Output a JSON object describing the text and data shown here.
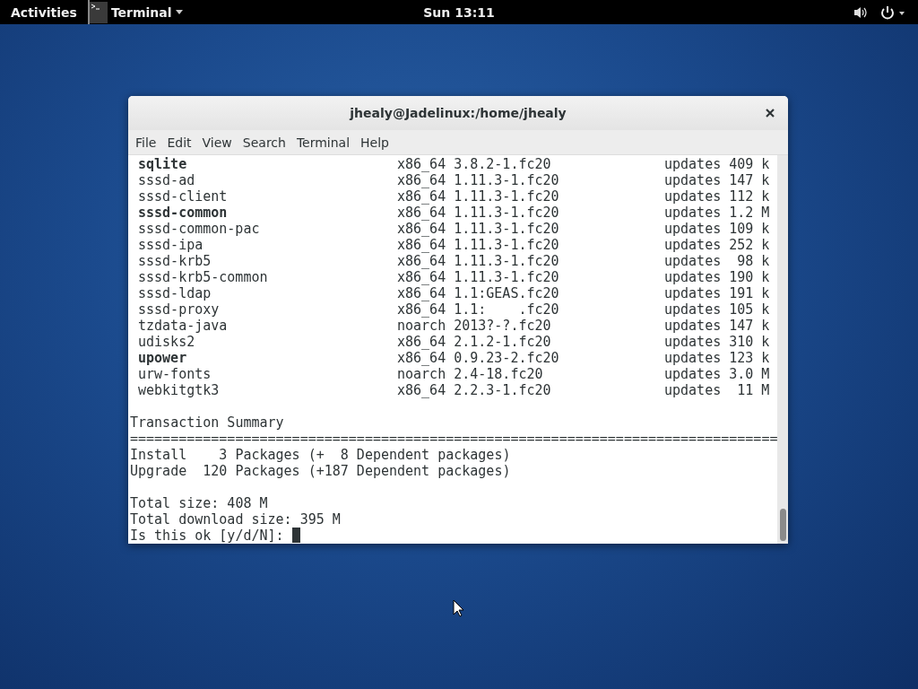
{
  "top_bar": {
    "activities": "Activities",
    "app_menu": "Terminal",
    "clock": "Sun 13:11"
  },
  "window": {
    "title": "jhealy@Jadelinux:/home/jhealy",
    "menu": [
      "File",
      "Edit",
      "View",
      "Search",
      "Terminal",
      "Help"
    ],
    "packages": [
      {
        "name": "sqlite",
        "bold": true,
        "arch": "x86_64",
        "version": "3.8.2-1.fc20",
        "repo": "updates",
        "size": "409 k"
      },
      {
        "name": "sssd-ad",
        "bold": false,
        "arch": "x86_64",
        "version": "1.11.3-1.fc20",
        "repo": "updates",
        "size": "147 k"
      },
      {
        "name": "sssd-client",
        "bold": false,
        "arch": "x86_64",
        "version": "1.11.3-1.fc20",
        "repo": "updates",
        "size": "112 k"
      },
      {
        "name": "sssd-common",
        "bold": true,
        "arch": "x86_64",
        "version": "1.11.3-1.fc20",
        "repo": "updates",
        "size": "1.2 M"
      },
      {
        "name": "sssd-common-pac",
        "bold": false,
        "arch": "x86_64",
        "version": "1.11.3-1.fc20",
        "repo": "updates",
        "size": "109 k"
      },
      {
        "name": "sssd-ipa",
        "bold": false,
        "arch": "x86_64",
        "version": "1.11.3-1.fc20",
        "repo": "updates",
        "size": "252 k"
      },
      {
        "name": "sssd-krb5",
        "bold": false,
        "arch": "x86_64",
        "version": "1.11.3-1.fc20",
        "repo": "updates",
        "size": "98 k"
      },
      {
        "name": "sssd-krb5-common",
        "bold": false,
        "arch": "x86_64",
        "version": "1.11.3-1.fc20",
        "repo": "updates",
        "size": "190 k"
      },
      {
        "name": "sssd-ldap",
        "bold": false,
        "arch": "x86_64",
        "version": "1.1:GEAS.fc20",
        "repo": "updates",
        "size": "191 k"
      },
      {
        "name": "sssd-proxy",
        "bold": false,
        "arch": "x86_64",
        "version": "1.1:    .fc20",
        "repo": "updates",
        "size": "105 k"
      },
      {
        "name": "tzdata-java",
        "bold": false,
        "arch": "noarch",
        "version": "2013?-?.fc20",
        "repo": "updates",
        "size": "147 k"
      },
      {
        "name": "udisks2",
        "bold": false,
        "arch": "x86_64",
        "version": "2.1.2-1.fc20",
        "repo": "updates",
        "size": "310 k"
      },
      {
        "name": "upower",
        "bold": true,
        "arch": "x86_64",
        "version": "0.9.23-2.fc20",
        "repo": "updates",
        "size": "123 k"
      },
      {
        "name": "urw-fonts",
        "bold": false,
        "arch": "noarch",
        "version": "2.4-18.fc20",
        "repo": "updates",
        "size": "3.0 M"
      },
      {
        "name": "webkitgtk3",
        "bold": false,
        "arch": "x86_64",
        "version": "2.2.3-1.fc20",
        "repo": "updates",
        "size": "11 M"
      }
    ],
    "summary_title": "Transaction Summary",
    "separator": "================================================================================",
    "summary_lines": [
      "Install    3 Packages (+  8 Dependent packages)",
      "Upgrade  120 Packages (+187 Dependent packages)"
    ],
    "size_lines": [
      "Total size: 408 M",
      "Total download size: 395 M"
    ],
    "prompt": "Is this ok [y/d/N]: "
  }
}
